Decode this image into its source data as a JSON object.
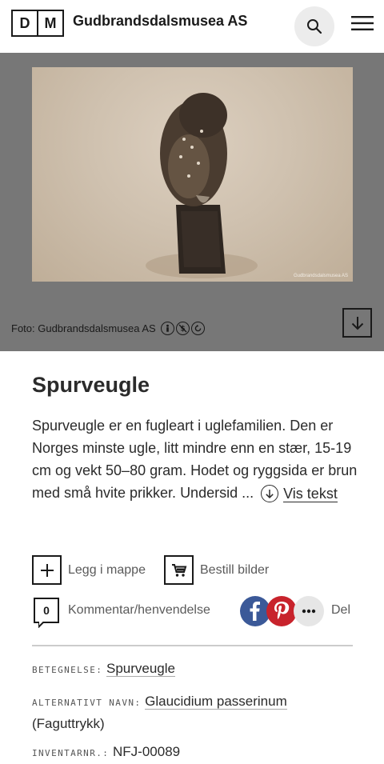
{
  "header": {
    "logo_letters": [
      "D",
      "M"
    ],
    "brand": "Gudbrandsdalsmusea AS"
  },
  "media": {
    "watermark": "Gudbrandsdalsmusea AS",
    "credit": "Foto: Gudbrandsdalsmusea AS"
  },
  "object": {
    "title": "Spurveugle",
    "description": "Spurveugle er en fugleart i uglefamilien. Den er Norges minste ugle, litt mindre enn en stær, 15-19 cm og vekt 50–80 gram. Hodet og ryggsida er brun med små hvite prikker. Undersid ...",
    "read_more": "Vis tekst"
  },
  "actions": {
    "add_folder": "Legg i mappe",
    "order_images": "Bestill bilder",
    "comment_count": "0",
    "comment": "Kommentar/henvendelse",
    "share": "Del"
  },
  "metadata": {
    "designation_key": "BETEGNELSE:",
    "designation_value": "Spurveugle",
    "alt_name_key": "ALTERNATIVT NAVN:",
    "alt_name_value": "Glaucidium passerinum",
    "alt_name_note": "(Faguttrykk)",
    "inventory_key": "INVENTARNR.:",
    "inventory_value": "NFJ-00089"
  },
  "colors": {
    "facebook": "#3b5998",
    "pinterest": "#c8232c",
    "media_background": "#777777"
  }
}
